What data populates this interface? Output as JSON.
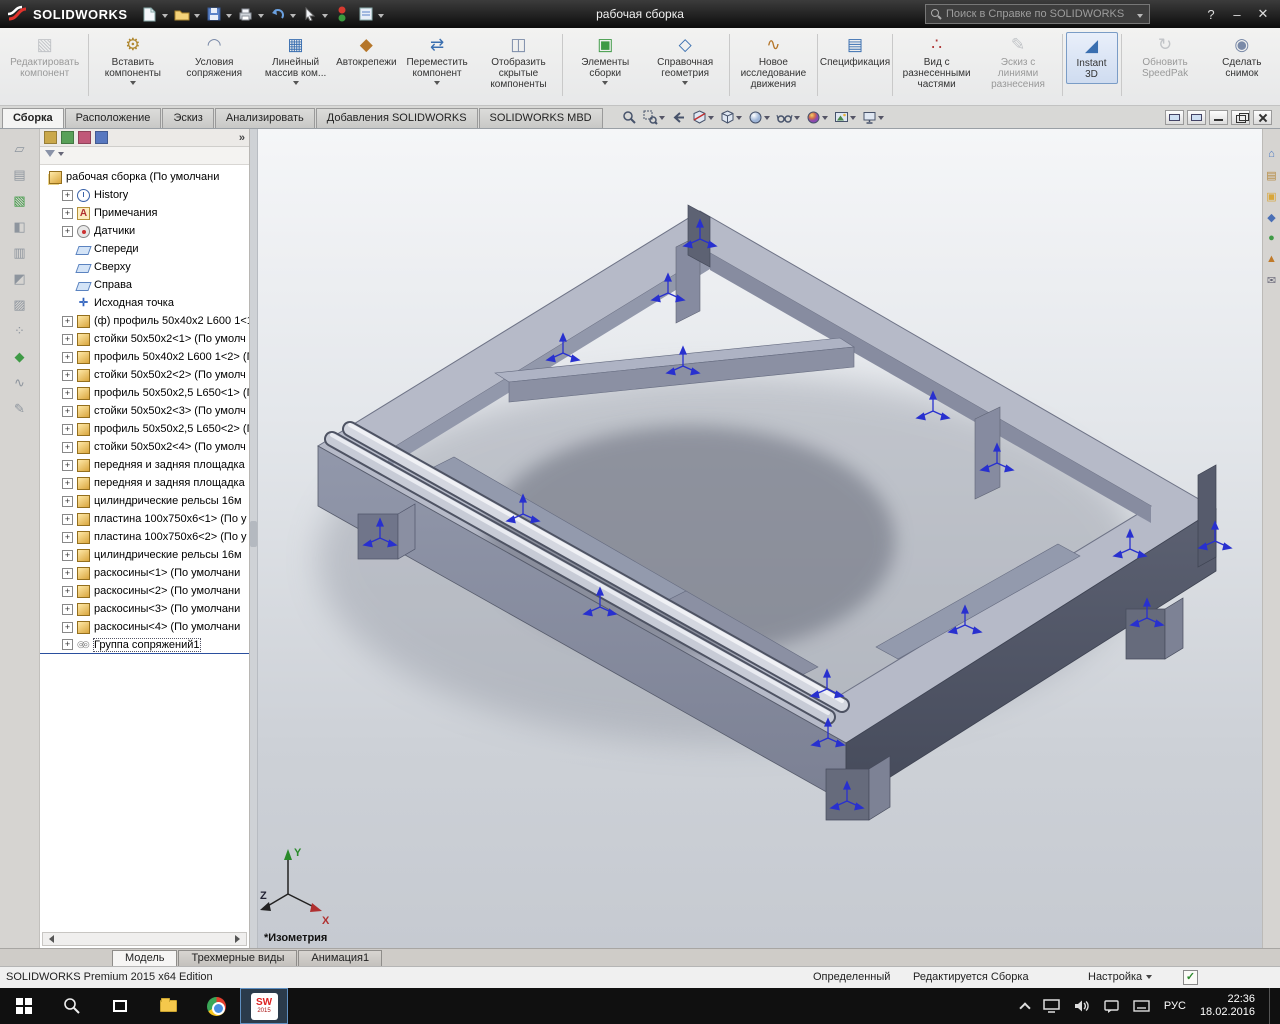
{
  "titlebar": {
    "app_name": "SOLIDWORKS",
    "doc_title": "рабочая сборка",
    "search": {
      "placeholder": "Поиск в Справке по SOLIDWORKS"
    },
    "icons": [
      "new-document",
      "open",
      "save",
      "print",
      "undo",
      "select",
      "rebuild",
      "options"
    ],
    "window": {
      "help": "?",
      "minimize": "–",
      "close": "✕"
    }
  },
  "ribbon": {
    "buttons": [
      {
        "label": "Редактировать компонент",
        "glyph": "▧",
        "enabled": false,
        "dropdown": false
      },
      {
        "label": "Вставить компоненты",
        "glyph": "⚙",
        "enabled": true,
        "dropdown": true
      },
      {
        "label": "Условия сопряжения",
        "glyph": "◠",
        "enabled": true,
        "dropdown": false
      },
      {
        "label": "Линейный массив ком...",
        "glyph": "▦",
        "enabled": true,
        "dropdown": true
      },
      {
        "label": "Автокрепежи",
        "glyph": "◆",
        "enabled": true,
        "dropdown": false
      },
      {
        "label": "Переместить компонент",
        "glyph": "⇄",
        "enabled": true,
        "dropdown": true
      },
      {
        "label": "Отобразить скрытые компоненты",
        "glyph": "◫",
        "enabled": true,
        "dropdown": false
      },
      {
        "label": "Элементы сборки",
        "glyph": "▣",
        "enabled": true,
        "dropdown": true
      },
      {
        "label": "Справочная геометрия",
        "glyph": "◇",
        "enabled": true,
        "dropdown": true
      },
      {
        "label": "Новое исследование движения",
        "glyph": "∿",
        "enabled": true,
        "dropdown": false
      },
      {
        "label": "Спецификация",
        "glyph": "▤",
        "enabled": true,
        "dropdown": false
      },
      {
        "label": "Вид с разнесенными частями",
        "glyph": "∴",
        "enabled": true,
        "dropdown": false
      },
      {
        "label": "Эскиз с линиями разнесения",
        "glyph": "✎",
        "enabled": false,
        "dropdown": false
      },
      {
        "label": "Instant 3D",
        "glyph": "◢",
        "enabled": true,
        "dropdown": false,
        "active": true
      },
      {
        "label": "Обновить SpeedPak",
        "glyph": "↻",
        "enabled": false,
        "dropdown": false
      },
      {
        "label": "Сделать снимок",
        "glyph": "◉",
        "enabled": true,
        "dropdown": false
      }
    ]
  },
  "command_tabs": {
    "items": [
      "Сборка",
      "Расположение",
      "Эскиз",
      "Анализировать",
      "Добавления SOLIDWORKS",
      "SOLIDWORKS MBD"
    ],
    "active": "Сборка"
  },
  "headsup": {
    "icons": [
      "zoom-fit",
      "zoom-area",
      "previous-view",
      "section-view",
      "view-orientation",
      "display-style",
      "hide-show-items",
      "edit-appearance",
      "apply-scene",
      "view-settings"
    ]
  },
  "feature_tree": {
    "expand_button": "»",
    "root": {
      "label": "рабочая сборка  (По умолчани",
      "icon": "assembly"
    },
    "items": [
      {
        "label": "History",
        "icon": "history",
        "expandable": true
      },
      {
        "label": "Примечания",
        "icon": "annotations",
        "expandable": true
      },
      {
        "label": "Датчики",
        "icon": "sensors",
        "expandable": true
      },
      {
        "label": "Спереди",
        "icon": "plane",
        "expandable": false
      },
      {
        "label": "Сверху",
        "icon": "plane",
        "expandable": false
      },
      {
        "label": "Справа",
        "icon": "plane",
        "expandable": false
      },
      {
        "label": "Исходная точка",
        "icon": "origin",
        "expandable": false
      },
      {
        "label": "(ф) профиль 50x40x2 L600 1<1",
        "icon": "part",
        "expandable": true
      },
      {
        "label": "стойки 50x50x2<1> (По умолч",
        "icon": "part",
        "expandable": true
      },
      {
        "label": "профиль 50x40x2 L600 1<2> (П",
        "icon": "part",
        "expandable": true
      },
      {
        "label": "стойки 50x50x2<2> (По умолч",
        "icon": "part",
        "expandable": true
      },
      {
        "label": "профиль 50x50x2,5 L650<1> (П",
        "icon": "part",
        "expandable": true
      },
      {
        "label": "стойки 50x50x2<3> (По умолч",
        "icon": "part",
        "expandable": true
      },
      {
        "label": "профиль 50x50x2,5 L650<2> (П",
        "icon": "part",
        "expandable": true
      },
      {
        "label": "стойки 50x50x2<4> (По умолч",
        "icon": "part",
        "expandable": true
      },
      {
        "label": "передняя и задняя площадка",
        "icon": "part",
        "expandable": true
      },
      {
        "label": "передняя и задняя площадка",
        "icon": "part",
        "expandable": true
      },
      {
        "label": "цилиндрические рельсы 16м",
        "icon": "part",
        "expandable": true
      },
      {
        "label": "пластина 100x750x6<1> (По у",
        "icon": "part",
        "expandable": true
      },
      {
        "label": "пластина 100x750x6<2> (По у",
        "icon": "part",
        "expandable": true
      },
      {
        "label": "цилиндрические рельсы 16м",
        "icon": "part",
        "expandable": true
      },
      {
        "label": "раскосины<1> (По умолчани",
        "icon": "part",
        "expandable": true
      },
      {
        "label": "раскосины<2> (По умолчани",
        "icon": "part",
        "expandable": true
      },
      {
        "label": "раскосины<3> (По умолчани",
        "icon": "part",
        "expandable": true
      },
      {
        "label": "раскосины<4> (По умолчани",
        "icon": "part",
        "expandable": true
      },
      {
        "label": "Группа сопряжений1",
        "icon": "mates",
        "expandable": true
      }
    ]
  },
  "viewport": {
    "view_label": "*Изометрия",
    "axis_labels": {
      "x": "X",
      "y": "Y",
      "z": "Z"
    }
  },
  "bottom_tabs": {
    "items": [
      "Модель",
      "Трехмерные виды",
      "Анимация1"
    ],
    "active": "Модель"
  },
  "statusbar": {
    "edition": "SOLIDWORKS Premium 2015 x64 Edition",
    "state": "Определенный",
    "mode": "Редактируется Сборка",
    "settings": "Настройка",
    "check_glyph": "✓"
  },
  "taskbar": {
    "apps": [
      "start",
      "search",
      "task-view",
      "file-explorer",
      "browser",
      "solidworks"
    ],
    "sw_icon_text": "SW",
    "sw_icon_year": "2015",
    "language": "РУС",
    "time": "22:36",
    "date": "18.02.2016"
  }
}
